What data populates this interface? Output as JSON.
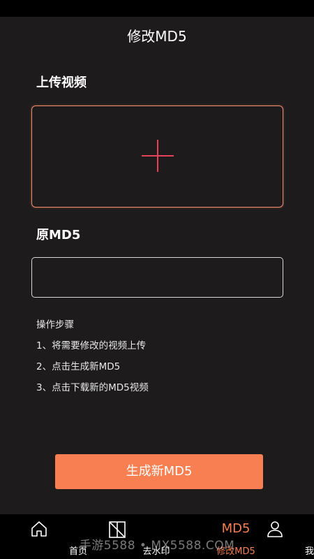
{
  "header": {
    "title": "修改MD5"
  },
  "upload": {
    "label": "上传视频"
  },
  "md5": {
    "label": "原MD5",
    "value": "",
    "placeholder": ""
  },
  "steps": {
    "title": "操作步骤",
    "items": [
      "1、将需要修改的视频上传",
      "2、点击生成新MD5",
      "3、点击下载新的MD5视频"
    ]
  },
  "action": {
    "generate_label": "生成新MD5"
  },
  "tabbar": {
    "tabs": [
      {
        "label": "首页",
        "icon": "home-icon"
      },
      {
        "label": "去水印",
        "icon": "crop-icon"
      },
      {
        "label": "修改MD5",
        "icon_text": "MD5",
        "active": true
      },
      {
        "label": "我的",
        "icon": "user-icon"
      }
    ]
  },
  "watermark": {
    "text": "手游5588 • MX5588.COM"
  },
  "colors": {
    "accent": "#f77f52",
    "plus": "#e6435a",
    "upload_border": "#f08a6e",
    "background": "#1d1b1c"
  }
}
